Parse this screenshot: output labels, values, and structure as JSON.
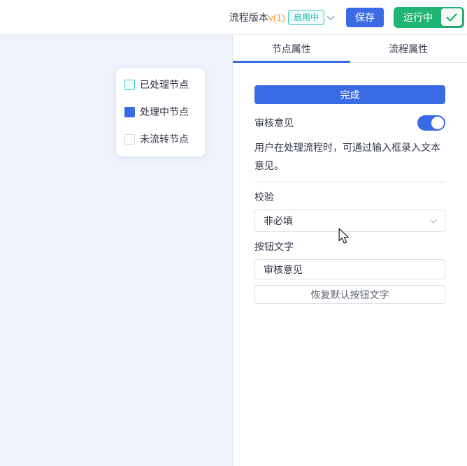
{
  "header": {
    "title": "流程版本",
    "version": "v(1)",
    "status_badge": "启用中",
    "save_label": "保存",
    "running_label": "运行中"
  },
  "canvas": {
    "legend": {
      "items": [
        {
          "label": "已处理节点"
        },
        {
          "label": "处理中节点"
        },
        {
          "label": "未流转节点"
        }
      ]
    }
  },
  "panel": {
    "tabs": [
      {
        "label": "节点属性",
        "active": true
      },
      {
        "label": "流程属性",
        "active": false
      }
    ],
    "finish_button": "完成",
    "review_label": "审核意见",
    "review_toggle": "on",
    "description": "用户在处理流程时，可通过输入框录入文本意见。",
    "validation_label": "校验",
    "validation_value": "非必填",
    "button_text_label": "按钮文字",
    "button_text_value": "审核意见",
    "restore_button": "恢复默认按钮文字"
  },
  "colors": {
    "accent_blue": "#3b6be4",
    "success_green": "#21b573",
    "badge_teal": "#1db5ae",
    "version_orange": "#ff9c30",
    "canvas_bg": "#f0f3fc"
  }
}
